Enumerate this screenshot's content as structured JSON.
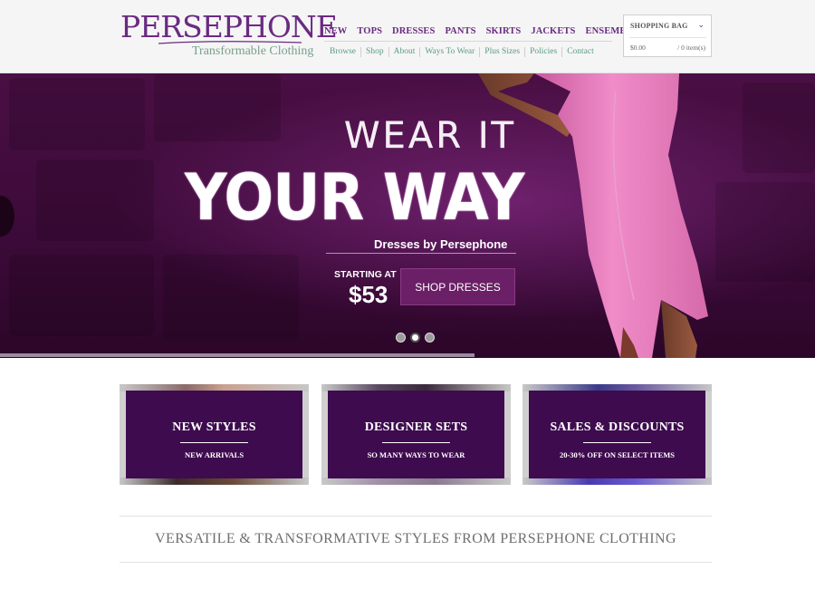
{
  "brand": {
    "name": "PERSEPHONE",
    "tagline": "Transformable Clothing",
    "color": "#6a2a82"
  },
  "nav": {
    "main": [
      "NEW",
      "TOPS",
      "DRESSES",
      "PANTS",
      "SKIRTS",
      "JACKETS",
      "ENSEMBLES"
    ],
    "sub": [
      "Browse",
      "Shop",
      "About",
      "Ways To Wear",
      "Plus Sizes",
      "Policies",
      "Contact"
    ]
  },
  "bag": {
    "title": "SHOPPING BAG",
    "total": "$0.00",
    "count": "/ 0 item(s)"
  },
  "hero": {
    "line1": "WEAR IT",
    "line2": "YOUR WAY",
    "byline": "Dresses by Persephone",
    "starting_label": "STARTING AT",
    "price": "$53",
    "button": "SHOP DRESSES",
    "slides": 3,
    "active_slide": 2
  },
  "promos": [
    {
      "title": "NEW STYLES",
      "subtitle": "NEW ARRIVALS"
    },
    {
      "title": "DESIGNER SETS",
      "subtitle": "SO MANY WAYS TO WEAR"
    },
    {
      "title": "SALES & DISCOUNTS",
      "subtitle": "20-30% OFF ON SELECT ITEMS"
    }
  ],
  "tagline": "VERSATILE & TRANSFORMATIVE STYLES FROM PERSEPHONE CLOTHING",
  "colors": {
    "accent_purple": "#6a2a82",
    "hero_bg": "#3b0a38",
    "promo_bg": "#3e0b4f",
    "subnav_green": "#5b9a86",
    "dress_pink": "#e77fbd"
  }
}
